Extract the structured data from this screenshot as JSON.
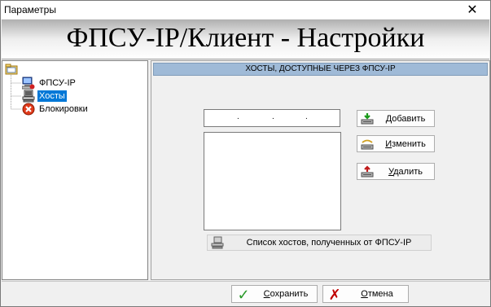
{
  "window": {
    "title": "Параметры",
    "close_glyph": "✕"
  },
  "banner": {
    "title": "ФПСУ-IP/Клиент - Настройки"
  },
  "tree": {
    "items": [
      {
        "label": "ФПСУ-IP",
        "icon": "computer-key-icon"
      },
      {
        "label": "Хосты",
        "icon": "host-computers-icon",
        "selected": true
      },
      {
        "label": "Блокировки",
        "icon": "blocked-icon"
      }
    ]
  },
  "panel": {
    "header": "ХОСТЫ, ДОСТУПНЫЕ ЧЕРЕЗ ФПСУ-IP",
    "ip_dots": [
      ".",
      ".",
      "."
    ],
    "buttons": {
      "add": {
        "mnemonic": "Д",
        "rest": "обавить"
      },
      "edit": {
        "mnemonic": "И",
        "rest": "зменить"
      },
      "delete": {
        "mnemonic": "У",
        "rest": "далить"
      },
      "fetch": "Список хостов, полученных от ФПСУ-IP"
    }
  },
  "footer": {
    "save": {
      "mnemonic": "С",
      "rest": "охранить"
    },
    "cancel": {
      "mnemonic": "О",
      "rest": "тмена"
    }
  },
  "colors": {
    "selection": "#0078d7",
    "header_bg": "#9fbad7",
    "check": "#2a9a2a",
    "cross": "#c00000"
  }
}
